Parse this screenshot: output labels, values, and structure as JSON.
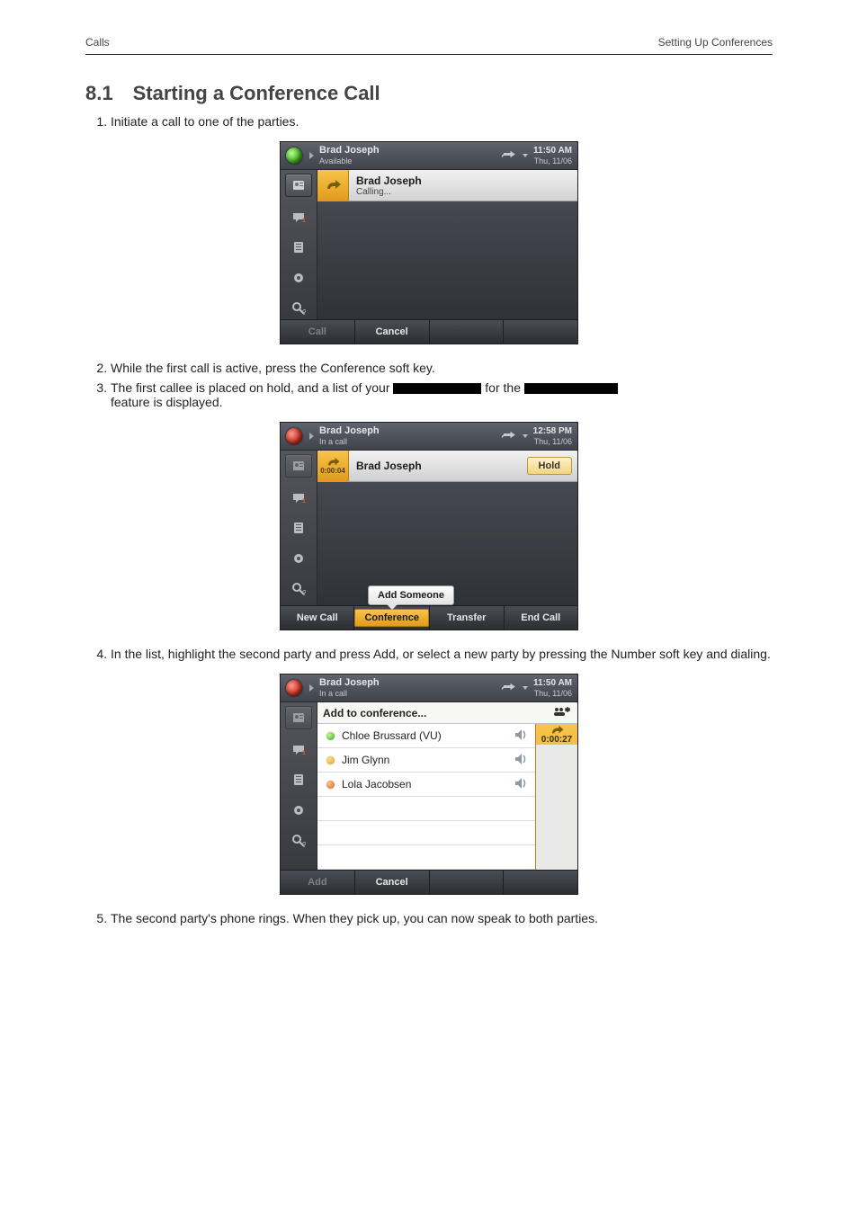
{
  "page": {
    "header_left": "Calls",
    "header_right": "Setting Up Conferences"
  },
  "section": {
    "number": "8.1",
    "title": "Starting a Conference Call"
  },
  "steps": {
    "s1": "Initiate a call to one of the parties.",
    "s2": "While the first call is active, press the Conference soft key.",
    "s3a_prefix": "The first callee is placed on hold, and a list of your ",
    "s3a_black1_w": 98,
    "s3a_mid": " for the ",
    "s3a_black2_w": 104,
    "s3b": "feature is displayed.",
    "s4": "In the list, highlight the second party and press Add, or select a new party by pressing the Number soft key and dialing.",
    "s5": "The second party's phone rings. When they pick up, you can now speak to both parties."
  },
  "panel1": {
    "user_name": "Brad Joseph",
    "user_status": "Available",
    "clock_time": "11:50 AM",
    "clock_date": "Thu, 11/06",
    "callee_name": "Brad Joseph",
    "callee_status": "Calling...",
    "softkeys": {
      "call": "Call",
      "cancel": "Cancel"
    }
  },
  "panel2": {
    "user_name": "Brad Joseph",
    "user_status": "In a call",
    "clock_time": "12:58 PM",
    "clock_date": "Thu, 11/06",
    "callee_name": "Brad Joseph",
    "call_timer": "0:00:04",
    "hold_label": "Hold",
    "bubble_text": "Add Someone",
    "softkeys": {
      "newcall": "New Call",
      "conference": "Conference",
      "transfer": "Transfer",
      "endcall": "End Call"
    }
  },
  "panel3": {
    "user_name": "Brad Joseph",
    "user_status": "In a call",
    "clock_time": "11:50 AM",
    "clock_date": "Thu, 11/06",
    "picker_title": "Add to conference...",
    "timer": "0:00:27",
    "contacts": [
      {
        "name": "Chloe Brussard (VU)",
        "presence": "green"
      },
      {
        "name": "Jim Glynn",
        "presence": "yellow"
      },
      {
        "name": "Lola Jacobsen",
        "presence": "orange"
      }
    ],
    "softkeys": {
      "add": "Add",
      "cancel": "Cancel"
    }
  },
  "icons": {
    "rail_contacts": "contacts-icon",
    "rail_voicemail": "voicemail-icon",
    "rail_calllog": "calllog-icon",
    "rail_settings": "gear-icon",
    "rail_search": "search-icon"
  }
}
